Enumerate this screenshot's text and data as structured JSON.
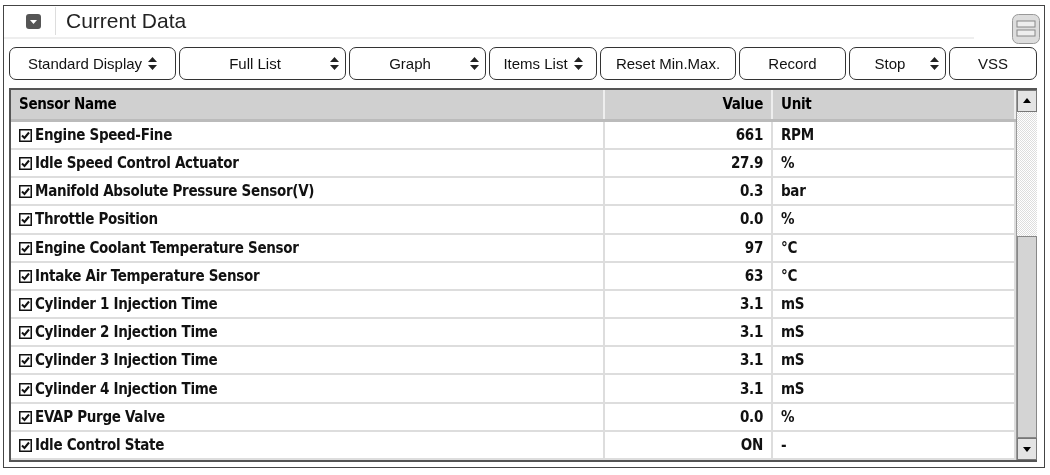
{
  "window": {
    "title": "Current Data"
  },
  "toolbar": [
    {
      "label": "Standard Display",
      "kind": "dropdown"
    },
    {
      "label": "Full List",
      "kind": "dropdown"
    },
    {
      "label": "Graph",
      "kind": "dropdown"
    },
    {
      "label": "Items List",
      "kind": "dropdown"
    },
    {
      "label": "Reset Min.Max.",
      "kind": "button"
    },
    {
      "label": "Record",
      "kind": "button"
    },
    {
      "label": "Stop",
      "kind": "dropdown"
    },
    {
      "label": "VSS",
      "kind": "button"
    }
  ],
  "table": {
    "columns": [
      "Sensor Name",
      "Value",
      "Unit"
    ],
    "rows": [
      {
        "name": "Engine Speed-Fine",
        "value": "661",
        "unit": "RPM",
        "checked": true
      },
      {
        "name": "Idle Speed Control Actuator",
        "value": "27.9",
        "unit": "%",
        "checked": true
      },
      {
        "name": "Manifold Absolute Pressure Sensor(V)",
        "value": "0.3",
        "unit": "bar",
        "checked": true
      },
      {
        "name": "Throttle Position",
        "value": "0.0",
        "unit": "%",
        "checked": true
      },
      {
        "name": "Engine Coolant Temperature Sensor",
        "value": "97",
        "unit": "°C",
        "checked": true
      },
      {
        "name": "Intake Air Temperature Sensor",
        "value": "63",
        "unit": "°C",
        "checked": true
      },
      {
        "name": "Cylinder 1 Injection Time",
        "value": "3.1",
        "unit": "mS",
        "checked": true
      },
      {
        "name": "Cylinder 2 Injection Time",
        "value": "3.1",
        "unit": "mS",
        "checked": true
      },
      {
        "name": "Cylinder 3 Injection Time",
        "value": "3.1",
        "unit": "mS",
        "checked": true
      },
      {
        "name": "Cylinder 4 Injection Time",
        "value": "3.1",
        "unit": "mS",
        "checked": true
      },
      {
        "name": "EVAP Purge Valve",
        "value": "0.0",
        "unit": "%",
        "checked": true
      },
      {
        "name": "Idle Control State",
        "value": "ON",
        "unit": "-",
        "checked": true
      }
    ]
  }
}
